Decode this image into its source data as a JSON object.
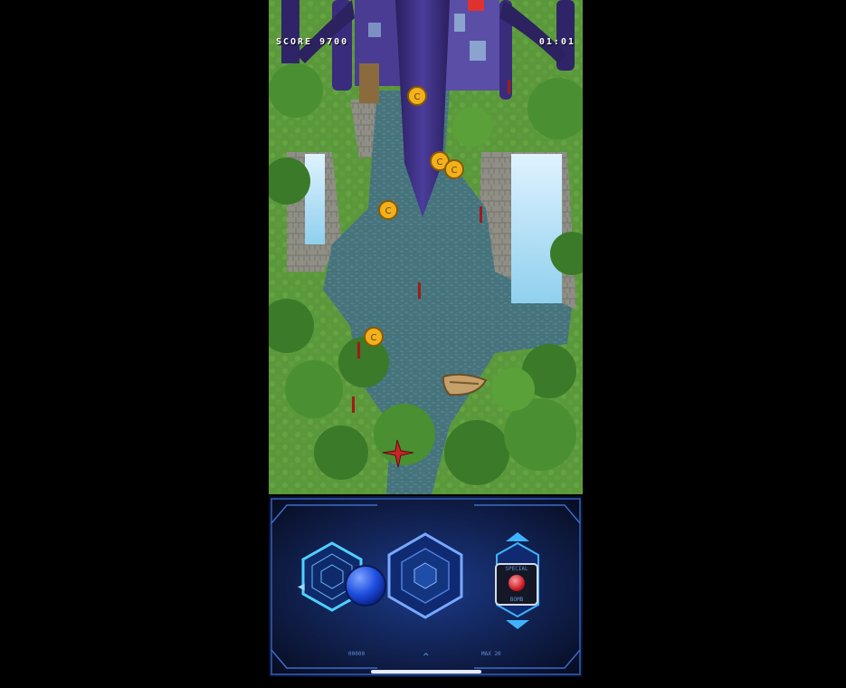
{
  "hud": {
    "score_label": "SCORE 9700",
    "timer": "01:01"
  },
  "control_panel": {
    "special_label": "SPECIAL",
    "bomb_label": "BOMB",
    "readout_left": "00000",
    "readout_right": "MAX 20"
  },
  "colors": {
    "grass": "#5e9a3e",
    "water": "#3f6f7c",
    "boss_hull": "#3b2e7e",
    "panel_bg": "#0d1530",
    "panel_glow": "#3fb3ff",
    "coin": "#f2b11c",
    "player_plane": "#c8242a"
  }
}
